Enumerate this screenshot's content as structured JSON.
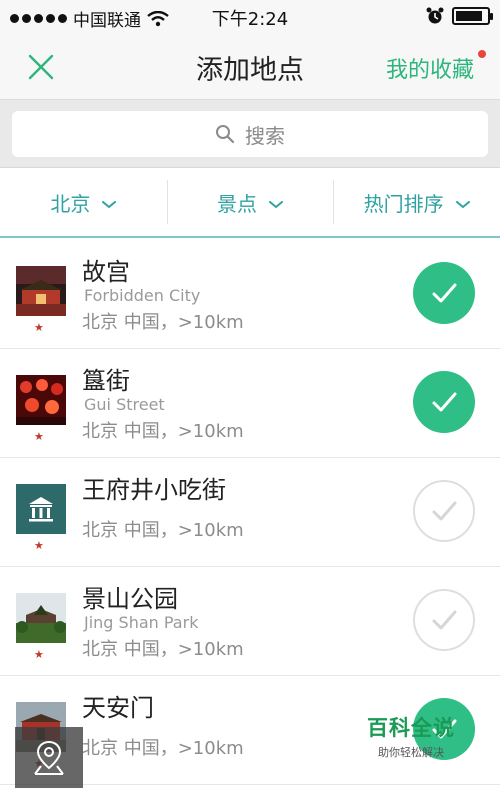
{
  "status_bar": {
    "carrier": "中国联通",
    "time": "下午2:24",
    "battery_level": 0.85
  },
  "nav": {
    "title": "添加地点",
    "favorites_label": "我的收藏",
    "close_icon": "close-icon"
  },
  "search": {
    "placeholder": "搜索"
  },
  "filters": [
    {
      "label": "北京"
    },
    {
      "label": "景点"
    },
    {
      "label": "热门排序"
    }
  ],
  "places": [
    {
      "name": "故宫",
      "english": "Forbidden City",
      "location": "北京 中国，>10km",
      "selected": true
    },
    {
      "name": "簋街",
      "english": "Gui Street",
      "location": "北京 中国，>10km",
      "selected": true
    },
    {
      "name": "王府井小吃街",
      "english": "",
      "location": "北京 中国，>10km",
      "selected": false
    },
    {
      "name": "景山公园",
      "english": "Jing Shan Park",
      "location": "北京 中国，>10km",
      "selected": false
    },
    {
      "name": "天安门",
      "english": "",
      "location": "北京 中国，>10km",
      "selected": true
    }
  ],
  "watermark": {
    "title": "百科全说",
    "subtitle": "助你轻松解决"
  },
  "colors": {
    "accent": "#2fbf86",
    "filter_text": "#2fa2a2",
    "badge": "#e8473b"
  }
}
